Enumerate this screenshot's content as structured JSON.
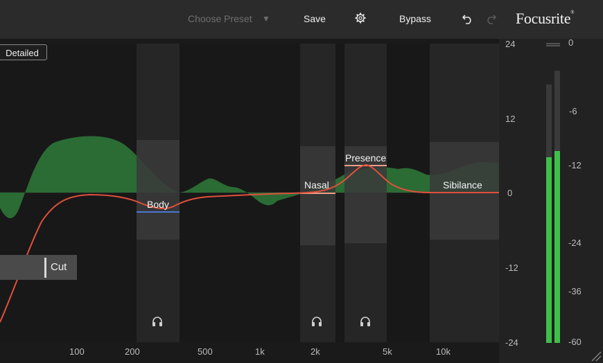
{
  "toolbar": {
    "preset_placeholder": "Choose Preset",
    "preset_arrow": "▼",
    "save_label": "Save",
    "settings_icon": "gear-icon",
    "bypass_label": "Bypass",
    "undo_icon": "undo-icon",
    "redo_icon": "redo-icon"
  },
  "brand": {
    "logo_text": "Focusrite",
    "trademark": "®"
  },
  "view_mode": {
    "label": "Detailed"
  },
  "filter": {
    "cut_label": "Cut"
  },
  "bands": [
    {
      "label": "Body",
      "line_color": "#4a78d6"
    },
    {
      "label": "Nasal",
      "line_color": "#f0a085"
    },
    {
      "label": "Presence",
      "line_color": "#f0a085"
    },
    {
      "label": "Sibilance",
      "line_color": "#e8d8d0"
    }
  ],
  "freq_axis": [
    "100",
    "200",
    "500",
    "1k",
    "2k",
    "5k",
    "10k"
  ],
  "gain_axis": [
    "24",
    "12",
    "0",
    "-12",
    "-24"
  ],
  "meter_scale": [
    "0",
    "-6",
    "-12",
    "-24",
    "-36",
    "-60"
  ],
  "meters": {
    "left_level": 0.64,
    "right_level": 0.66
  },
  "colors": {
    "eq_curve": "#e0503c",
    "spectrum": "#2f7a3a",
    "meter": "#3fbf4a",
    "band_zone": "#3a3a3a"
  }
}
